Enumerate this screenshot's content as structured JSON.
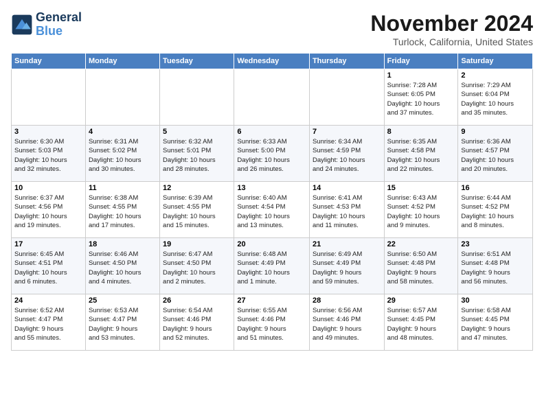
{
  "logo": {
    "line1": "General",
    "line2": "Blue"
  },
  "title": "November 2024",
  "location": "Turlock, California, United States",
  "days_of_week": [
    "Sunday",
    "Monday",
    "Tuesday",
    "Wednesday",
    "Thursday",
    "Friday",
    "Saturday"
  ],
  "weeks": [
    [
      {
        "num": "",
        "info": ""
      },
      {
        "num": "",
        "info": ""
      },
      {
        "num": "",
        "info": ""
      },
      {
        "num": "",
        "info": ""
      },
      {
        "num": "",
        "info": ""
      },
      {
        "num": "1",
        "info": "Sunrise: 7:28 AM\nSunset: 6:05 PM\nDaylight: 10 hours\nand 37 minutes."
      },
      {
        "num": "2",
        "info": "Sunrise: 7:29 AM\nSunset: 6:04 PM\nDaylight: 10 hours\nand 35 minutes."
      }
    ],
    [
      {
        "num": "3",
        "info": "Sunrise: 6:30 AM\nSunset: 5:03 PM\nDaylight: 10 hours\nand 32 minutes."
      },
      {
        "num": "4",
        "info": "Sunrise: 6:31 AM\nSunset: 5:02 PM\nDaylight: 10 hours\nand 30 minutes."
      },
      {
        "num": "5",
        "info": "Sunrise: 6:32 AM\nSunset: 5:01 PM\nDaylight: 10 hours\nand 28 minutes."
      },
      {
        "num": "6",
        "info": "Sunrise: 6:33 AM\nSunset: 5:00 PM\nDaylight: 10 hours\nand 26 minutes."
      },
      {
        "num": "7",
        "info": "Sunrise: 6:34 AM\nSunset: 4:59 PM\nDaylight: 10 hours\nand 24 minutes."
      },
      {
        "num": "8",
        "info": "Sunrise: 6:35 AM\nSunset: 4:58 PM\nDaylight: 10 hours\nand 22 minutes."
      },
      {
        "num": "9",
        "info": "Sunrise: 6:36 AM\nSunset: 4:57 PM\nDaylight: 10 hours\nand 20 minutes."
      }
    ],
    [
      {
        "num": "10",
        "info": "Sunrise: 6:37 AM\nSunset: 4:56 PM\nDaylight: 10 hours\nand 19 minutes."
      },
      {
        "num": "11",
        "info": "Sunrise: 6:38 AM\nSunset: 4:55 PM\nDaylight: 10 hours\nand 17 minutes."
      },
      {
        "num": "12",
        "info": "Sunrise: 6:39 AM\nSunset: 4:55 PM\nDaylight: 10 hours\nand 15 minutes."
      },
      {
        "num": "13",
        "info": "Sunrise: 6:40 AM\nSunset: 4:54 PM\nDaylight: 10 hours\nand 13 minutes."
      },
      {
        "num": "14",
        "info": "Sunrise: 6:41 AM\nSunset: 4:53 PM\nDaylight: 10 hours\nand 11 minutes."
      },
      {
        "num": "15",
        "info": "Sunrise: 6:43 AM\nSunset: 4:52 PM\nDaylight: 10 hours\nand 9 minutes."
      },
      {
        "num": "16",
        "info": "Sunrise: 6:44 AM\nSunset: 4:52 PM\nDaylight: 10 hours\nand 8 minutes."
      }
    ],
    [
      {
        "num": "17",
        "info": "Sunrise: 6:45 AM\nSunset: 4:51 PM\nDaylight: 10 hours\nand 6 minutes."
      },
      {
        "num": "18",
        "info": "Sunrise: 6:46 AM\nSunset: 4:50 PM\nDaylight: 10 hours\nand 4 minutes."
      },
      {
        "num": "19",
        "info": "Sunrise: 6:47 AM\nSunset: 4:50 PM\nDaylight: 10 hours\nand 2 minutes."
      },
      {
        "num": "20",
        "info": "Sunrise: 6:48 AM\nSunset: 4:49 PM\nDaylight: 10 hours\nand 1 minute."
      },
      {
        "num": "21",
        "info": "Sunrise: 6:49 AM\nSunset: 4:49 PM\nDaylight: 9 hours\nand 59 minutes."
      },
      {
        "num": "22",
        "info": "Sunrise: 6:50 AM\nSunset: 4:48 PM\nDaylight: 9 hours\nand 58 minutes."
      },
      {
        "num": "23",
        "info": "Sunrise: 6:51 AM\nSunset: 4:48 PM\nDaylight: 9 hours\nand 56 minutes."
      }
    ],
    [
      {
        "num": "24",
        "info": "Sunrise: 6:52 AM\nSunset: 4:47 PM\nDaylight: 9 hours\nand 55 minutes."
      },
      {
        "num": "25",
        "info": "Sunrise: 6:53 AM\nSunset: 4:47 PM\nDaylight: 9 hours\nand 53 minutes."
      },
      {
        "num": "26",
        "info": "Sunrise: 6:54 AM\nSunset: 4:46 PM\nDaylight: 9 hours\nand 52 minutes."
      },
      {
        "num": "27",
        "info": "Sunrise: 6:55 AM\nSunset: 4:46 PM\nDaylight: 9 hours\nand 51 minutes."
      },
      {
        "num": "28",
        "info": "Sunrise: 6:56 AM\nSunset: 4:46 PM\nDaylight: 9 hours\nand 49 minutes."
      },
      {
        "num": "29",
        "info": "Sunrise: 6:57 AM\nSunset: 4:45 PM\nDaylight: 9 hours\nand 48 minutes."
      },
      {
        "num": "30",
        "info": "Sunrise: 6:58 AM\nSunset: 4:45 PM\nDaylight: 9 hours\nand 47 minutes."
      }
    ]
  ]
}
